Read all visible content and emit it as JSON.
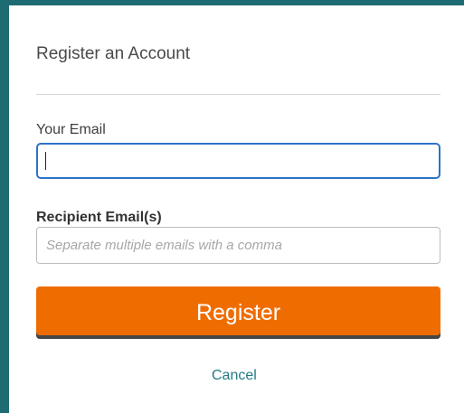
{
  "dialog": {
    "title": "Register an Account",
    "your_email_label": "Your Email",
    "your_email_value": "",
    "recipient_emails_label": "Recipient Email(s)",
    "recipient_emails_placeholder": "Separate multiple emails with a comma",
    "register_label": "Register",
    "cancel_label": "Cancel"
  },
  "colors": {
    "border_accent": "#1f6b73",
    "focus_border": "#2b74c8",
    "button_orange": "#ef6d00",
    "button_shadow": "#454545",
    "link_teal": "#217a86"
  }
}
